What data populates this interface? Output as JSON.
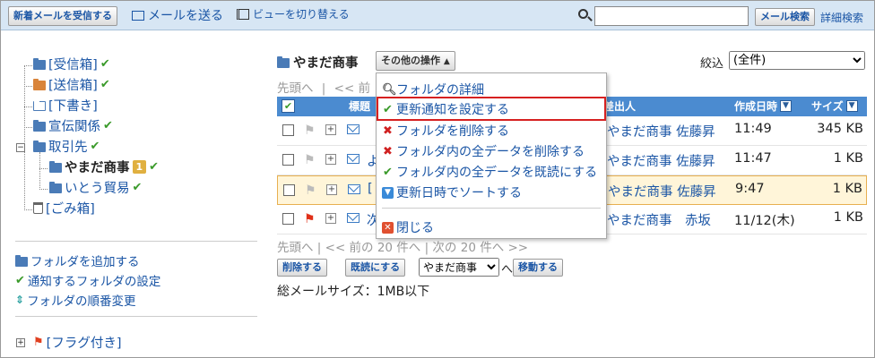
{
  "toolbar": {
    "receive_label": "新着メールを受信する",
    "send_label": "メールを送る",
    "switch_view_label": "ビューを切り替える",
    "search_button": "メール検索",
    "advanced_search": "詳細検索",
    "search_value": ""
  },
  "sidebar": {
    "folders": [
      {
        "label": "[受信箱]",
        "check": "✔"
      },
      {
        "label": "[送信箱]",
        "check": "✔"
      },
      {
        "label": "[下書き]"
      },
      {
        "label": "宣伝関係",
        "check": "✔"
      },
      {
        "label": "取引先",
        "check": "✔"
      },
      {
        "label": "やまだ商事",
        "badge": "1",
        "check": "✔"
      },
      {
        "label": "いとう貿易",
        "check": "✔"
      },
      {
        "label": "[ごみ箱]"
      }
    ],
    "add_folder": "フォルダを追加する",
    "notify_settings": "通知するフォルダの設定",
    "reorder": "フォルダの順番変更",
    "flagged": "[フラグ付き]"
  },
  "main": {
    "folder_title": "やまだ商事",
    "other_ops": "その他の操作",
    "filter_label": "絞込",
    "filter_value": "(全件)",
    "nav_top": {
      "first": "先頭へ",
      "prev": "<< 前",
      "sep": "|"
    },
    "columns": {
      "subject": "標題",
      "sender": "差出人",
      "created": "作成日時",
      "size": "サイズ"
    },
    "rows": [
      {
        "subject": "",
        "sender": "やまだ商事 佐藤昇",
        "date": "11:49",
        "size": "345 KB",
        "flag": "gray"
      },
      {
        "subject": "よ",
        "sender": "やまだ商事 佐藤昇",
        "date": "11:47",
        "size": "1 KB",
        "flag": "gray"
      },
      {
        "subject": "[",
        "sender": "やまだ商事 佐藤昇",
        "date": "9:47",
        "size": "1 KB",
        "flag": "gray"
      },
      {
        "subject": "次",
        "sender": "やまだ商事　赤坂",
        "date": "11/12(木)",
        "size": "1 KB",
        "flag": "red"
      }
    ],
    "nav_bottom": "先頭へ | << 前の 20 件へ | 次の 20 件へ >>",
    "delete_btn": "削除する",
    "mark_read_btn": "既読にする",
    "move_target": "やまだ商事",
    "move_to": "へ",
    "move_btn": "移動する",
    "total_size": "総メールサイズ：1MB以下"
  },
  "menu": {
    "items": [
      {
        "label": "フォルダの詳細",
        "icon": "magnifier-icon"
      },
      {
        "label": "更新通知を設定する",
        "icon": "check-icon"
      },
      {
        "label": "フォルダを削除する",
        "icon": "x-icon"
      },
      {
        "label": "フォルダ内の全データを削除する",
        "icon": "x-icon"
      },
      {
        "label": "フォルダ内の全データを既読にする",
        "icon": "check-icon"
      },
      {
        "label": "更新日時でソートする",
        "icon": "sort-icon"
      },
      {
        "label": "閉じる",
        "icon": "close-icon"
      }
    ]
  },
  "colors": {
    "accent": "#1a55a5",
    "header_blue": "#4b8bd0",
    "highlight_red": "#d62020"
  }
}
